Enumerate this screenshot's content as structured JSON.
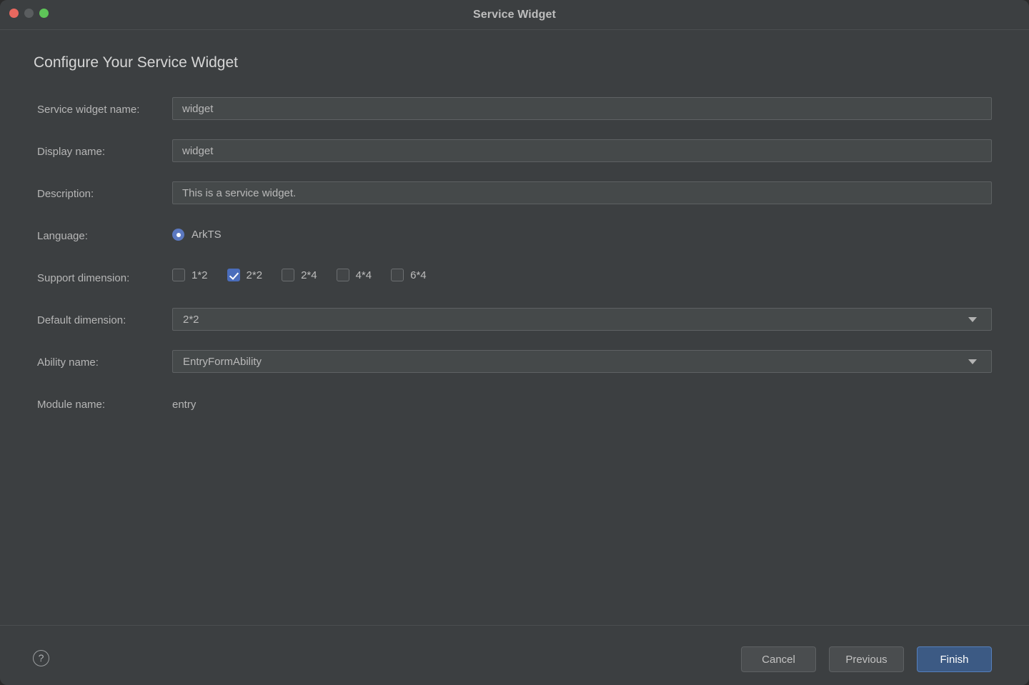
{
  "window": {
    "title": "Service Widget",
    "controls": [
      {
        "name": "close",
        "color": "#e8685f"
      },
      {
        "name": "minimize",
        "color": "#5a5d5f"
      },
      {
        "name": "maximize",
        "color": "#5ec558"
      }
    ]
  },
  "page": {
    "heading": "Configure Your Service Widget"
  },
  "form": {
    "service_widget_name": {
      "label": "Service widget name:",
      "value": "widget",
      "placeholder": "Service widget name"
    },
    "display_name": {
      "label": "Display name:",
      "value": "widget",
      "placeholder": "Display name"
    },
    "description": {
      "label": "Description:",
      "value": "This is a service widget.",
      "placeholder": "Description"
    },
    "language": {
      "label": "Language:",
      "options": [
        "ArkTS"
      ],
      "selected": "ArkTS"
    },
    "support_dimension": {
      "label": "Support dimension:",
      "options": [
        {
          "label": "1*2",
          "checked": false
        },
        {
          "label": "2*2",
          "checked": true
        },
        {
          "label": "2*4",
          "checked": false
        },
        {
          "label": "4*4",
          "checked": false
        },
        {
          "label": "6*4",
          "checked": false
        }
      ]
    },
    "default_dimension": {
      "label": "Default dimension:",
      "value": "2*2",
      "icon": "chevron-down-icon"
    },
    "ability_name": {
      "label": "Ability name:",
      "value": "EntryFormAbility",
      "icon": "chevron-down-icon"
    },
    "module_name": {
      "label": "Module name:",
      "value": "entry"
    }
  },
  "footer": {
    "help_icon": "question-mark-icon",
    "help_label": "?",
    "buttons": {
      "cancel": "Cancel",
      "previous": "Previous",
      "finish": "Finish"
    }
  },
  "colors": {
    "accent_blue": "#4a6dbb",
    "primary_button": "#3c5a84",
    "primary_button_border": "#5680bd",
    "window_bg": "#3c3f41",
    "field_bg": "#45494a",
    "field_border": "#5e6163"
  }
}
